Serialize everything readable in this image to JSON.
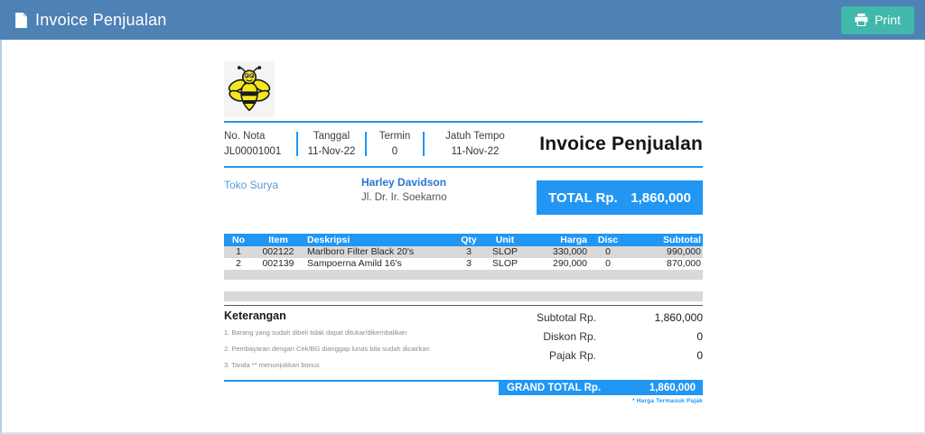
{
  "topbar": {
    "title": "Invoice Penjualan",
    "print_label": "Print"
  },
  "invoice": {
    "title": "Invoice Penjualan",
    "meta": [
      {
        "label": "No. Nota",
        "value": "JL00001001"
      },
      {
        "label": "Tanggal",
        "value": "11-Nov-22"
      },
      {
        "label": "Termin",
        "value": "0"
      },
      {
        "label": "Jatuh Tempo",
        "value": "11-Nov-22"
      }
    ],
    "customer": {
      "store": "Toko Surya",
      "name": "Harley Davidson",
      "address": "Jl. Dr. Ir. Soekarno"
    },
    "total_box": {
      "label": "TOTAL Rp.",
      "value": "1,860,000"
    },
    "table": {
      "columns": [
        "No",
        "Item",
        "Deskripsi",
        "Qty",
        "Unit",
        "Harga",
        "Disc",
        "Subtotal"
      ],
      "rows": [
        [
          "1",
          "002122",
          "Marlboro Filter Black 20's",
          "3",
          "SLOP",
          "330,000",
          "0",
          "990,000"
        ],
        [
          "2",
          "002139",
          "Sampoerna Amild 16's",
          "3",
          "SLOP",
          "290,000",
          "0",
          "870,000"
        ]
      ]
    },
    "keterangan": {
      "title": "Keterangan",
      "notes": [
        "1. Barang yang sudah dibeli tidak dapat ditukar/dikembalikan",
        "2. Pembayaran dengan Cek/BG dianggap lunas bila sudah dicairkan",
        "3. Tanda ** menunjukkan bonus"
      ]
    },
    "totals": [
      {
        "label": "Subtotal Rp.",
        "value": "1,860,000"
      },
      {
        "label": "Diskon Rp.",
        "value": "0"
      },
      {
        "label": "Pajak Rp.",
        "value": "0"
      }
    ],
    "grand_total": {
      "label": "GRAND TOTAL Rp.",
      "value": "1,860,000"
    },
    "footnote": "* Harga Termasuk Pajak"
  },
  "icons": {
    "topbar_document": "document-icon",
    "print": "printer-icon",
    "logo": "bee-logo"
  },
  "colors": {
    "topbar": "#4e81b4",
    "print_button": "#41b8ab",
    "accent_blue": "#2196f3",
    "row_gray": "#d9d9d9",
    "store_text": "#5b9bd5",
    "customer_name": "#2776d2"
  }
}
